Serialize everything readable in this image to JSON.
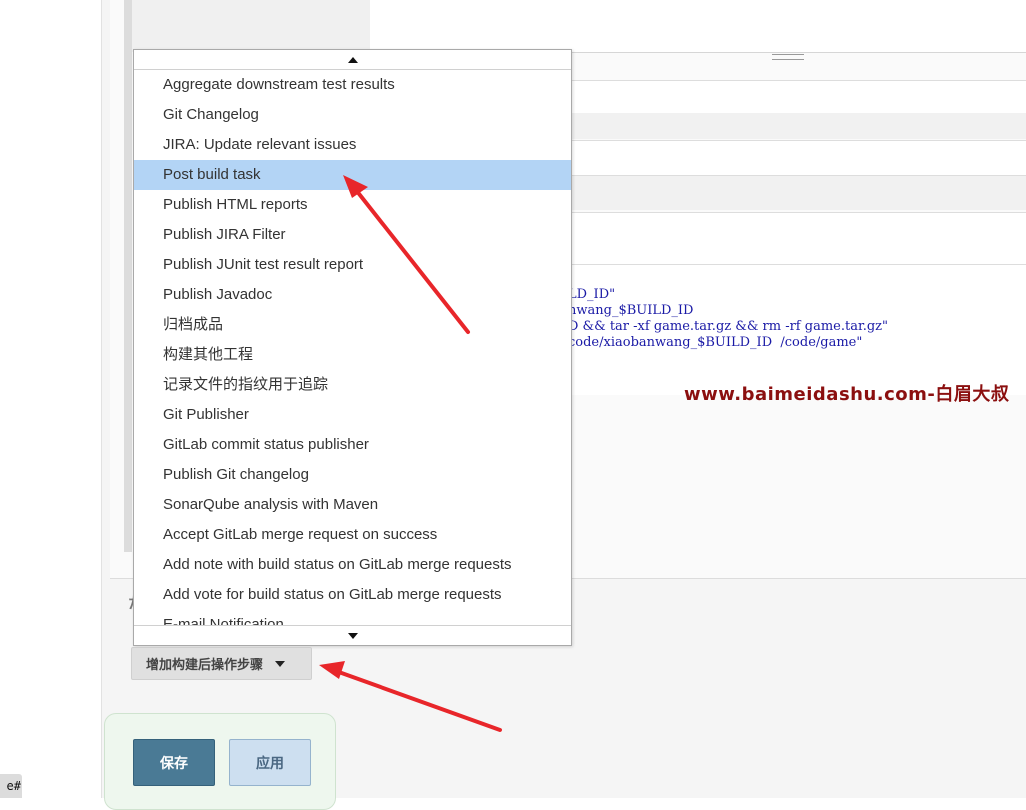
{
  "dropdown": {
    "items": [
      {
        "label": "Aggregate downstream test results"
      },
      {
        "label": "Git Changelog"
      },
      {
        "label": "JIRA: Update relevant issues"
      },
      {
        "label": "Post build task"
      },
      {
        "label": "Publish HTML reports"
      },
      {
        "label": "Publish JIRA Filter"
      },
      {
        "label": "Publish JUnit test result report"
      },
      {
        "label": "Publish Javadoc"
      },
      {
        "label": "归档成品"
      },
      {
        "label": "构建其他工程"
      },
      {
        "label": "记录文件的指纹用于追踪"
      },
      {
        "label": "Git Publisher"
      },
      {
        "label": "GitLab commit status publisher"
      },
      {
        "label": "Publish Git changelog"
      },
      {
        "label": "SonarQube analysis with Maven"
      },
      {
        "label": "Accept GitLab merge request on success"
      },
      {
        "label": "Add note with build status on GitLab merge requests"
      },
      {
        "label": "Add vote for build status on GitLab merge requests"
      },
      {
        "label": "E-mail Notification"
      }
    ],
    "selected_index": 3
  },
  "code": {
    "lines": [
      "LD_ID\"",
      "nwang_$BUILD_ID",
      "D && tar -xf game.tar.gz && rm -rf game.tar.gz\"",
      "code/xiaobanwang_$BUILD_ID  /code/game\""
    ]
  },
  "watermark": "www.baimeidashu.com-白眉大叔",
  "add_step_button": {
    "label": "增加构建后操作步骤"
  },
  "hidden_label": "た",
  "save_button": {
    "label": "保存"
  },
  "apply_button": {
    "label": "应用"
  },
  "corner_tag": "e#",
  "colors": {
    "selected_item": "#b3d4f5",
    "save_button": "#4a7a95",
    "apply_button": "#cddff0",
    "annotation_arrow": "#e8262a",
    "watermark": "#8b0f0f"
  }
}
